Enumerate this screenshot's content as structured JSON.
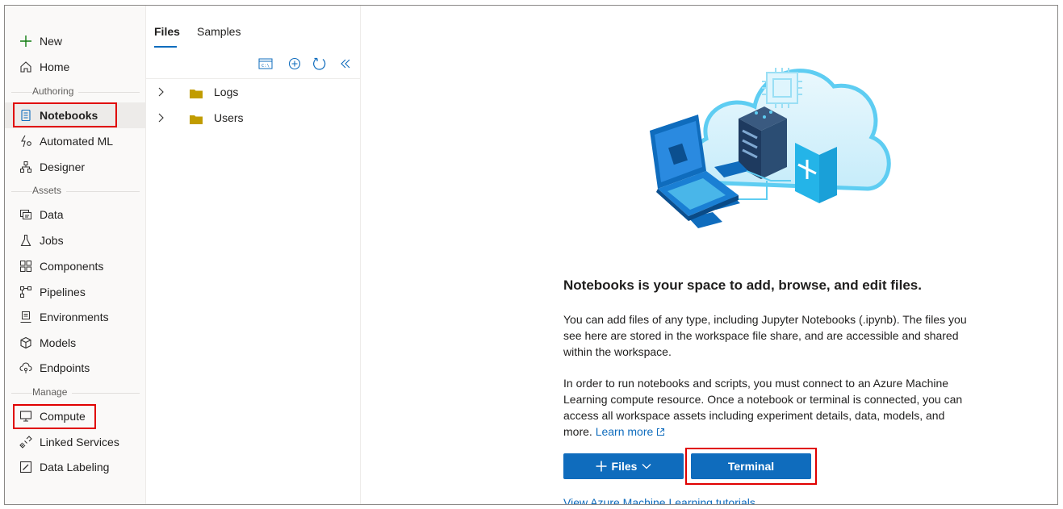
{
  "nav": {
    "new_label": "New",
    "home_label": "Home",
    "authoring_label": "Authoring",
    "notebooks_label": "Notebooks",
    "automated_ml_label": "Automated ML",
    "designer_label": "Designer",
    "assets_label": "Assets",
    "data_label": "Data",
    "jobs_label": "Jobs",
    "components_label": "Components",
    "pipelines_label": "Pipelines",
    "environments_label": "Environments",
    "models_label": "Models",
    "endpoints_label": "Endpoints",
    "manage_label": "Manage",
    "compute_label": "Compute",
    "linked_services_label": "Linked Services",
    "data_labeling_label": "Data Labeling",
    "selected": "Notebooks"
  },
  "file_pane": {
    "tabs": [
      "Files",
      "Samples"
    ],
    "active_tab": "Files",
    "toolbar_icons": [
      "terminal-icon",
      "add-file-icon",
      "refresh-icon",
      "collapse-pane-icon"
    ],
    "tree": [
      {
        "name": "Logs",
        "icon": "folder-icon"
      },
      {
        "name": "Users",
        "icon": "folder-icon"
      }
    ]
  },
  "main": {
    "heading": "Notebooks is your space to add, browse, and edit files.",
    "para1": "You can add files of any type, including Jupyter Notebooks (.ipynb). The files you see here are stored in the workspace file share, and are accessible and shared within the workspace.",
    "para2": "In order to run notebooks and scripts, you must connect to an Azure Machine Learning compute resource. Once a notebook or terminal is connected, you can access all workspace assets including experiment details, data, models, and more.",
    "learn_more": "Learn more",
    "files_button": "Files",
    "terminal_button": "Terminal",
    "tutorials_link": "View Azure Machine Learning tutorials"
  },
  "colors": {
    "accent": "#0f6cbd",
    "highlight": "#e00000",
    "folder": "#c19c00",
    "nav_bg": "#faf9f8",
    "new_plus": "#107c10"
  }
}
